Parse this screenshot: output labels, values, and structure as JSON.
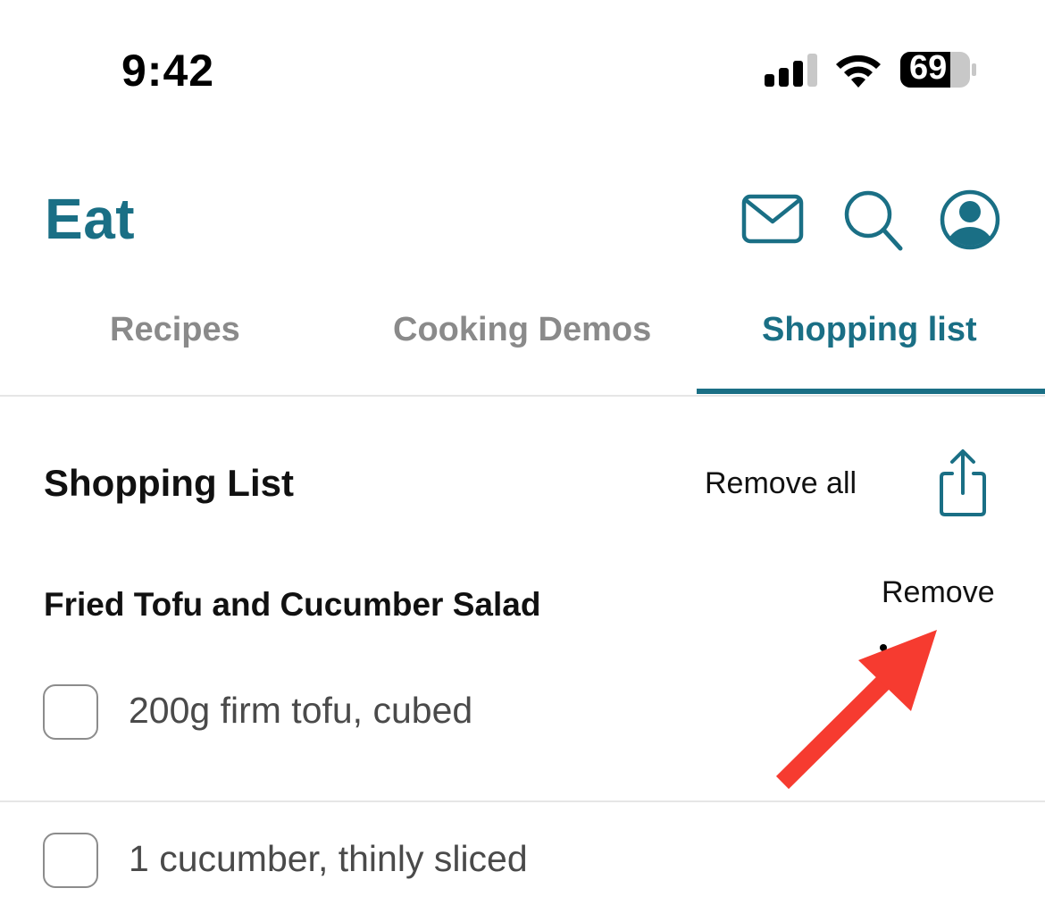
{
  "status_bar": {
    "time": "9:42",
    "battery": "69",
    "signal_icon": "cellular-signal-icon",
    "wifi_icon": "wifi-icon"
  },
  "header": {
    "title": "Eat",
    "icons": [
      "mail-icon",
      "search-icon",
      "account-icon"
    ]
  },
  "tabs": [
    {
      "label": "Recipes",
      "active": false
    },
    {
      "label": "Cooking Demos",
      "active": false
    },
    {
      "label": "Shopping list",
      "active": true
    }
  ],
  "shopping_list": {
    "title": "Shopping List",
    "remove_all_label": "Remove all",
    "share_icon": "share-icon",
    "recipes": [
      {
        "title": "Fried Tofu and Cucumber Salad",
        "remove_label": "Remove",
        "items": [
          {
            "text": "200g firm tofu, cubed",
            "checked": false
          },
          {
            "text": "1 cucumber, thinly sliced",
            "checked": false
          }
        ]
      }
    ]
  },
  "colors": {
    "accent": "#1a6f85",
    "inactive_tab": "#8a8a8a",
    "annotation_arrow": "#f63b30"
  }
}
